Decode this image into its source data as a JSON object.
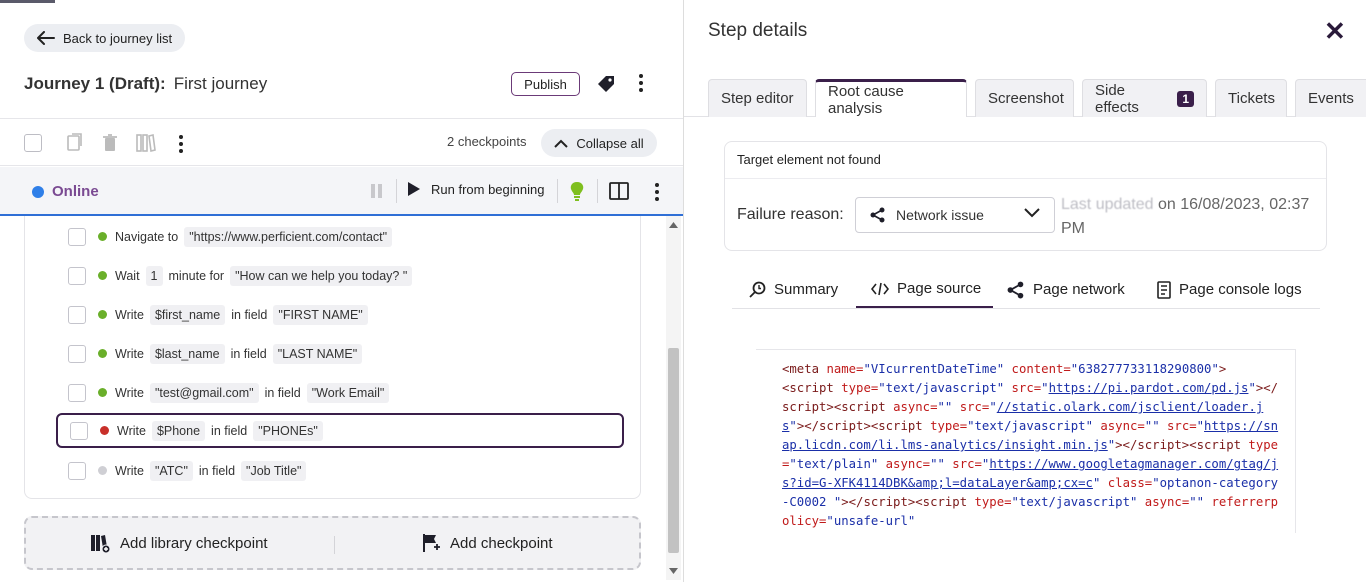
{
  "header": {
    "back_label": "Back to journey list",
    "journey_prefix": "Journey 1 (Draft):",
    "journey_name": "First journey",
    "publish_label": "Publish"
  },
  "toolbar": {
    "checkpoint_count": "2 checkpoints",
    "collapse_label": "Collapse all"
  },
  "status": {
    "label": "Online",
    "run_label": "Run from beginning",
    "accent_color": "#2f6fd6"
  },
  "steps": [
    {
      "parts": [
        "Navigate to",
        "\"https://www.perficient.com/contact\""
      ],
      "status": "passed"
    },
    {
      "parts": [
        "Wait",
        "1",
        "minute for",
        "\"How can we help you today? \""
      ],
      "status": "passed"
    },
    {
      "parts": [
        "Write",
        "$first_name",
        "in field",
        "\"FIRST NAME\""
      ],
      "status": "passed"
    },
    {
      "parts": [
        "Write",
        "$last_name",
        "in field",
        "\"LAST NAME\""
      ],
      "status": "passed"
    },
    {
      "parts": [
        "Write",
        "\"test@gmail.com\"",
        "in field",
        "\"Work Email\""
      ],
      "status": "passed"
    },
    {
      "parts": [
        "Write",
        "$Phone",
        "in field",
        "\"PHONEs\""
      ],
      "status": "failed"
    },
    {
      "parts": [
        "Write",
        "\"ATC\"",
        "in field",
        "\"Job Title\""
      ],
      "status": "pending"
    }
  ],
  "status_colors": {
    "passed": "#6aaf2a",
    "failed": "#c8302a",
    "pending": "#cfcfd4"
  },
  "add": {
    "library_label": "Add library checkpoint",
    "checkpoint_label": "Add checkpoint"
  },
  "panel": {
    "title": "Step details",
    "tabs": [
      {
        "label": "Step editor"
      },
      {
        "label": "Root cause analysis"
      },
      {
        "label": "Screenshot"
      },
      {
        "label": "Side effects",
        "badge": "1"
      },
      {
        "label": "Tickets"
      },
      {
        "label": "Events"
      }
    ],
    "rca": {
      "message": "Target element not found",
      "failure_label": "Failure reason:",
      "reason": "Network issue",
      "updated_blurred": "Last updated",
      "updated_date": "on 16/08/2023, 02:37",
      "updated_pm": "PM"
    },
    "subtabs": [
      {
        "label": "Summary"
      },
      {
        "label": "Page source"
      },
      {
        "label": "Page network"
      },
      {
        "label": "Page console logs"
      }
    ]
  }
}
